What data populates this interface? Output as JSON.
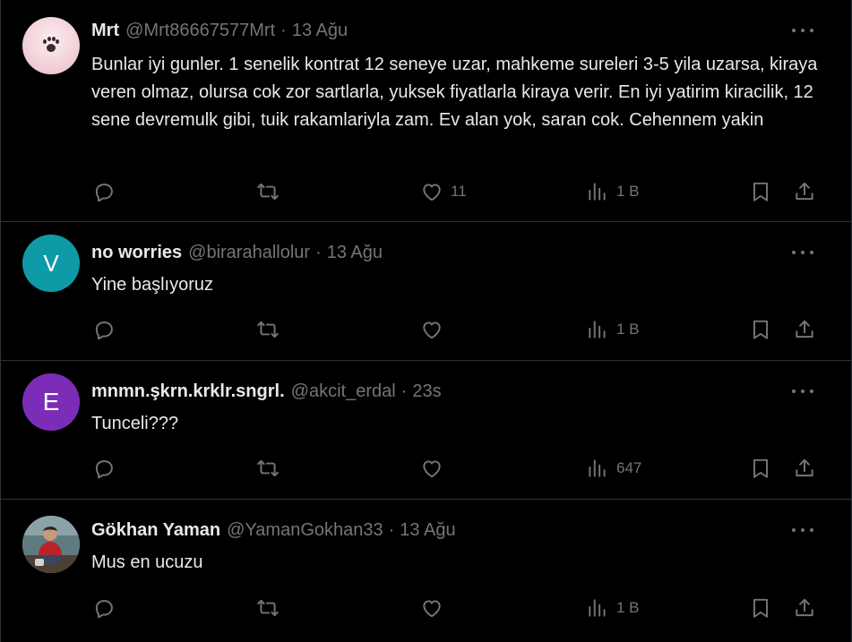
{
  "tweets": [
    {
      "name": "Mrt",
      "handle": "@Mrt86667577Mrt",
      "separator": "·",
      "time": "13 Ağu",
      "text": "Bunlar iyi gunler. 1 senelik kontrat 12 seneye uzar, mahkeme sureleri 3-5 yila uzarsa, kiraya veren olmaz, olursa cok zor sartlarla, yuksek fiyatlarla kiraya verir. En iyi yatirim kiracilik, 12 sene devremulk gibi, tuik rakamlariyla zam. Ev alan yok, saran cok. Cehennem yakin",
      "avatar_letter": "",
      "likes": "11",
      "views": "1 B"
    },
    {
      "name": "no worries",
      "handle": "@birarahallolur",
      "separator": "·",
      "time": "13 Ağu",
      "text": "Yine başlıyoruz",
      "avatar_letter": "V",
      "likes": "",
      "views": "1 B"
    },
    {
      "name": "mnmn.şkrn.krklr.sngrl.",
      "handle": "@akcit_erdal",
      "separator": "·",
      "time": "23s",
      "text": "Tunceli???",
      "avatar_letter": "E",
      "likes": "",
      "views": "647"
    },
    {
      "name": "Gökhan Yaman",
      "handle": "@YamanGokhan33",
      "separator": "·",
      "time": "13 Ağu",
      "text": "Mus en ucuzu",
      "avatar_letter": "",
      "likes": "",
      "views": "1 B"
    }
  ],
  "icons": {
    "reply": "reply-icon",
    "retweet": "retweet-icon",
    "like": "heart-icon",
    "views": "views-icon",
    "bookmark": "bookmark-icon",
    "share": "share-icon",
    "more": "more-dots-icon"
  },
  "colors": {
    "background": "#000000",
    "text": "#e7e9ea",
    "muted": "#71767b",
    "divider": "#2f3336",
    "avatar_v": "#0f9aa8",
    "avatar_e": "#7b2db8"
  }
}
